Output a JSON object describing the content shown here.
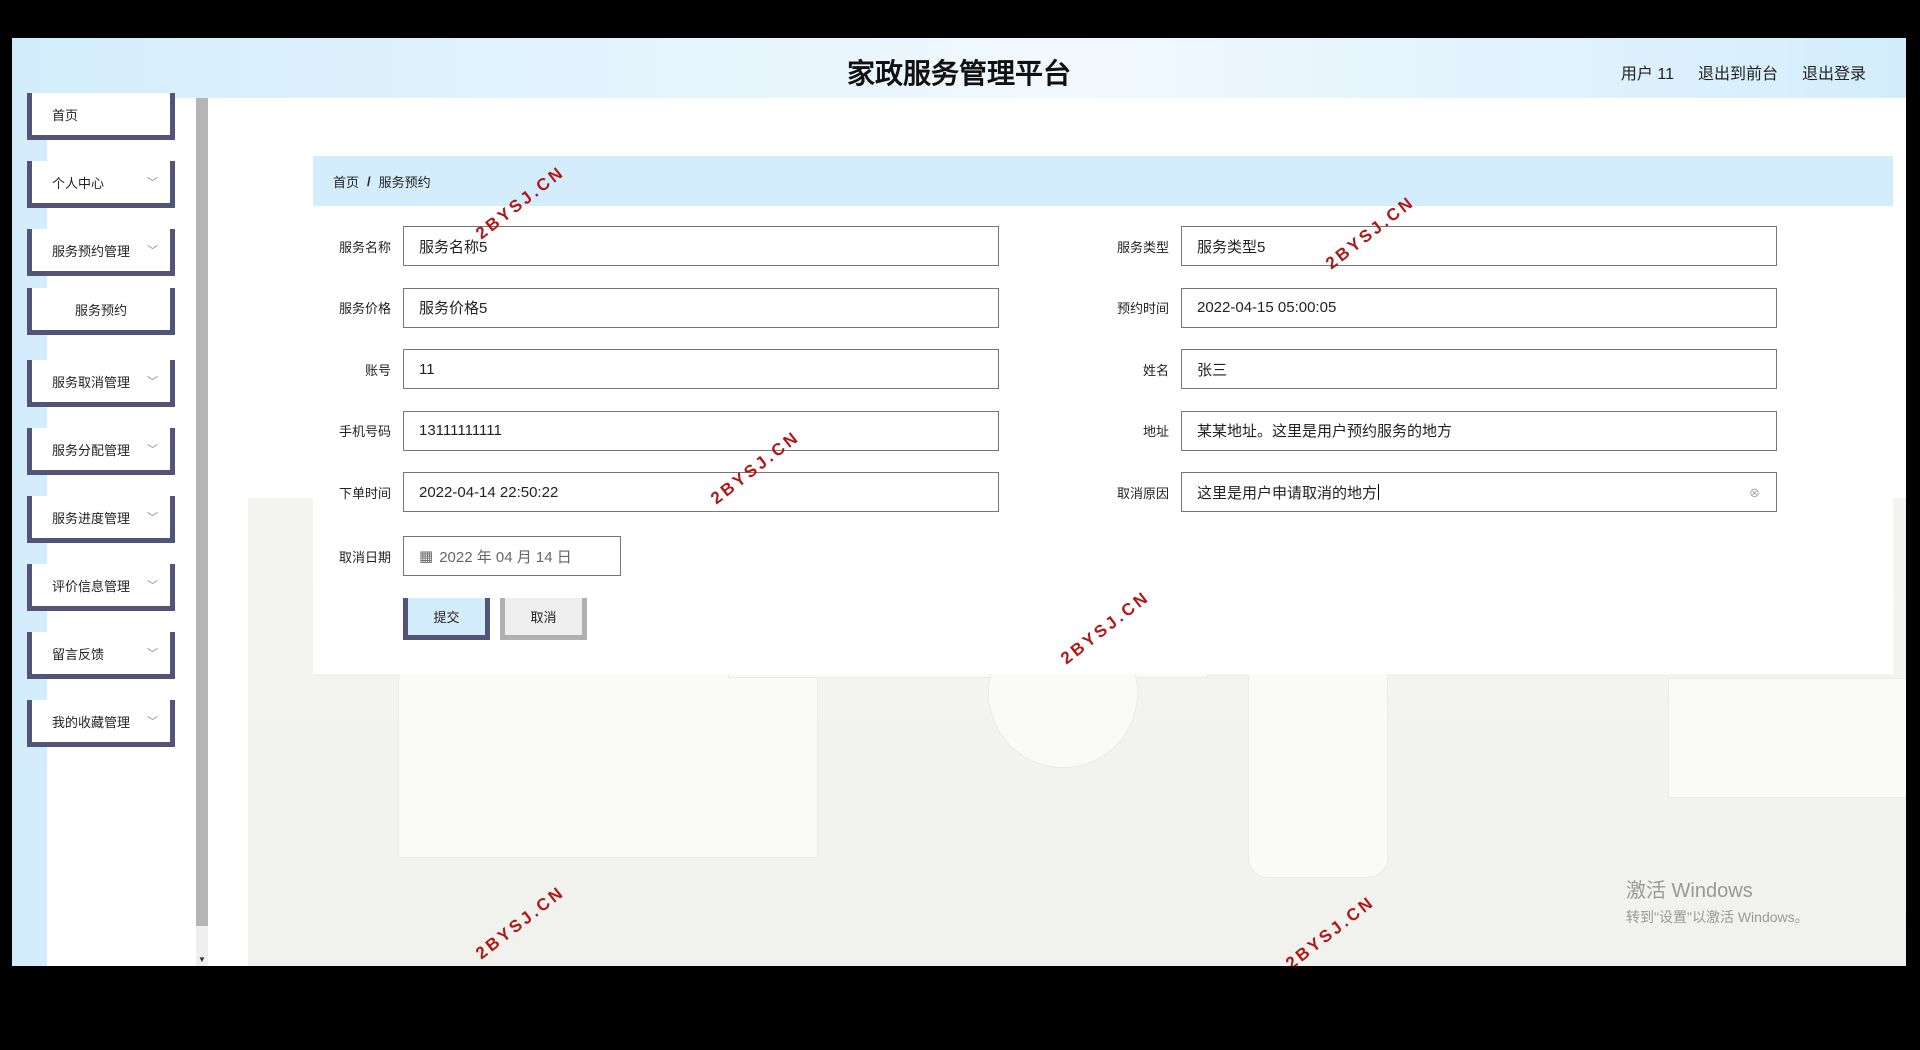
{
  "header": {
    "title": "家政服务管理平台",
    "user": "用户 11",
    "to_front": "退出到前台",
    "logout": "退出登录"
  },
  "sidebar": {
    "items": [
      {
        "label": "首页",
        "chevron": false
      },
      {
        "label": "个人中心",
        "chevron": true
      },
      {
        "label": "服务预约管理",
        "chevron": true
      },
      {
        "label": "服务预约",
        "chevron": false,
        "sub": true
      },
      {
        "label": "服务取消管理",
        "chevron": true
      },
      {
        "label": "服务分配管理",
        "chevron": true
      },
      {
        "label": "服务进度管理",
        "chevron": true
      },
      {
        "label": "评价信息管理",
        "chevron": true
      },
      {
        "label": "留言反馈",
        "chevron": true
      },
      {
        "label": "我的收藏管理",
        "chevron": true
      }
    ]
  },
  "breadcrumb": {
    "home": "首页",
    "sep": "/",
    "current": "服务预约"
  },
  "form": {
    "left": [
      {
        "label": "服务名称",
        "value": "服务名称5"
      },
      {
        "label": "服务价格",
        "value": "服务价格5"
      },
      {
        "label": "账号",
        "value": "11"
      },
      {
        "label": "手机号码",
        "value": "13111111111"
      },
      {
        "label": "下单时间",
        "value": "2022-04-14 22:50:22"
      }
    ],
    "right": [
      {
        "label": "服务类型",
        "value": "服务类型5"
      },
      {
        "label": "预约时间",
        "value": "2022-04-15 05:00:05"
      },
      {
        "label": "姓名",
        "value": "张三"
      },
      {
        "label": "地址",
        "value": "某某地址。这里是用户预约服务的地方"
      },
      {
        "label": "取消原因",
        "value": "这里是用户申请取消的地方"
      }
    ],
    "cancel_date": {
      "label": "取消日期",
      "value": "2022 年 04 月 14 日"
    },
    "submit": "提交",
    "cancel": "取消"
  },
  "watermark": "2BYSJ.CN",
  "windows": {
    "line1": "激活 Windows",
    "line2": "转到\"设置\"以激活 Windows。"
  },
  "colors": {
    "menu_border": "#545479",
    "accent_bg": "#d3edfc",
    "watermark": "#b01818"
  }
}
